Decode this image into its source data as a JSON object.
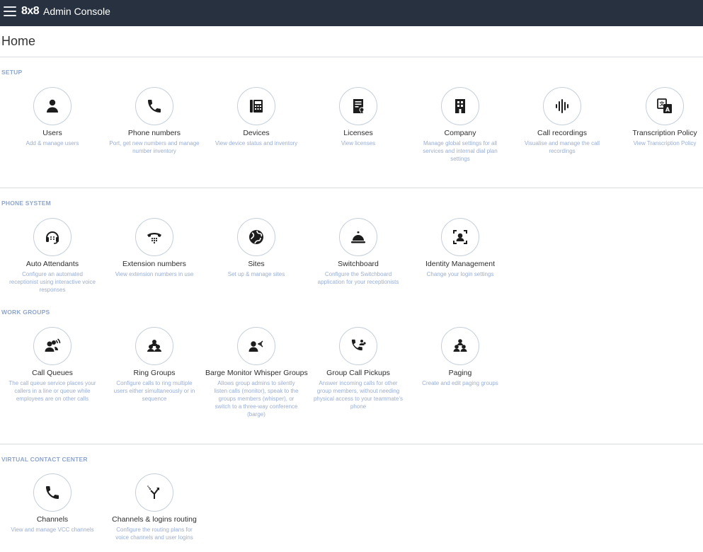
{
  "header": {
    "brand": "8x8",
    "title": "Admin Console"
  },
  "page": {
    "title": "Home"
  },
  "sections": [
    {
      "label": "SETUP",
      "tiles": [
        {
          "title": "Users",
          "desc": "Add & manage users",
          "icon": "user-icon"
        },
        {
          "title": "Phone numbers",
          "desc": "Port, get new numbers and manage number inventory",
          "icon": "phone-icon"
        },
        {
          "title": "Devices",
          "desc": "View device status and inventory",
          "icon": "desk-phone-icon"
        },
        {
          "title": "Licenses",
          "desc": "View licenses",
          "icon": "license-icon"
        },
        {
          "title": "Company",
          "desc": "Manage global settings for all services and internal dial plan settings",
          "icon": "building-icon"
        },
        {
          "title": "Call recordings",
          "desc": "Visualise and manage the call recordings",
          "icon": "waveform-icon"
        },
        {
          "title": "Transcription Policy",
          "desc": "View Transcription Policy",
          "icon": "translate-icon"
        }
      ]
    },
    {
      "label": "PHONE SYSTEM",
      "tiles": [
        {
          "title": "Auto Attendants",
          "desc": "Configure an automated receptionist using interactive voice responses",
          "icon": "headset-icon"
        },
        {
          "title": "Extension numbers",
          "desc": "View extension numbers in use",
          "icon": "dialpad-phone-icon"
        },
        {
          "title": "Sites",
          "desc": "Set up & manage sites",
          "icon": "globe-icon"
        },
        {
          "title": "Switchboard",
          "desc": "Configure the Switchboard application for your receptionists",
          "icon": "bell-icon"
        },
        {
          "title": "Identity Management",
          "desc": "Change your login settings",
          "icon": "identity-icon"
        }
      ]
    },
    {
      "label": "WORK GROUPS",
      "tiles": [
        {
          "title": "Call Queues",
          "desc": "The call queue service places your callers in a line or queue while employees are on other calls",
          "icon": "queue-icon"
        },
        {
          "title": "Ring Groups",
          "desc": "Configure calls to ring multiple users either simultaneously or in sequence",
          "icon": "group-icon"
        },
        {
          "title": "Barge Monitor Whisper Groups",
          "desc": "Allows group admins to silently listen calls (monitor), speak to the groups members (whisper), or switch to a three-way conference (barge)",
          "icon": "whisper-icon"
        },
        {
          "title": "Group Call Pickups",
          "desc": "Answer incoming calls for other group members, without needing physical access to your teammate's phone",
          "icon": "pickup-icon"
        },
        {
          "title": "Paging",
          "desc": "Create and edit paging groups",
          "icon": "paging-icon"
        }
      ]
    },
    {
      "label": "VIRTUAL CONTACT CENTER",
      "tiles": [
        {
          "title": "Channels",
          "desc": "View and manage VCC channels",
          "icon": "phone-icon"
        },
        {
          "title": "Channels & logins routing",
          "desc": "Configure the routing plans for voice channels and user logins",
          "icon": "routing-icon"
        }
      ]
    }
  ]
}
